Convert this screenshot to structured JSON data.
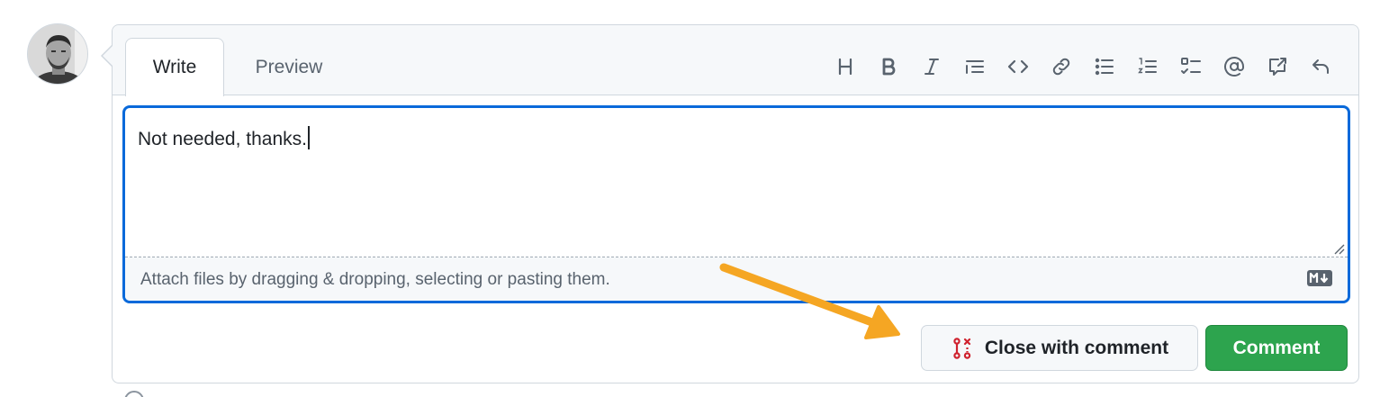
{
  "tabs": {
    "write": "Write",
    "preview": "Preview"
  },
  "toolbar": {
    "icons": [
      "heading-icon",
      "bold-icon",
      "italic-icon",
      "quote-icon",
      "code-icon",
      "link-icon",
      "unordered-list-icon",
      "ordered-list-icon",
      "task-list-icon",
      "mention-icon",
      "cross-reference-icon",
      "saved-replies-icon"
    ]
  },
  "editor": {
    "value": "Not needed, thanks.",
    "attach_text": "Attach files by dragging & dropping, selecting or pasting them."
  },
  "actions": {
    "close_with_comment_label": "Close with comment",
    "comment_label": "Comment"
  },
  "colors": {
    "accent_blue": "#0969da",
    "comment_green": "#2da44e",
    "close_red": "#cf222e",
    "annotation_arrow": "#f5a623"
  }
}
